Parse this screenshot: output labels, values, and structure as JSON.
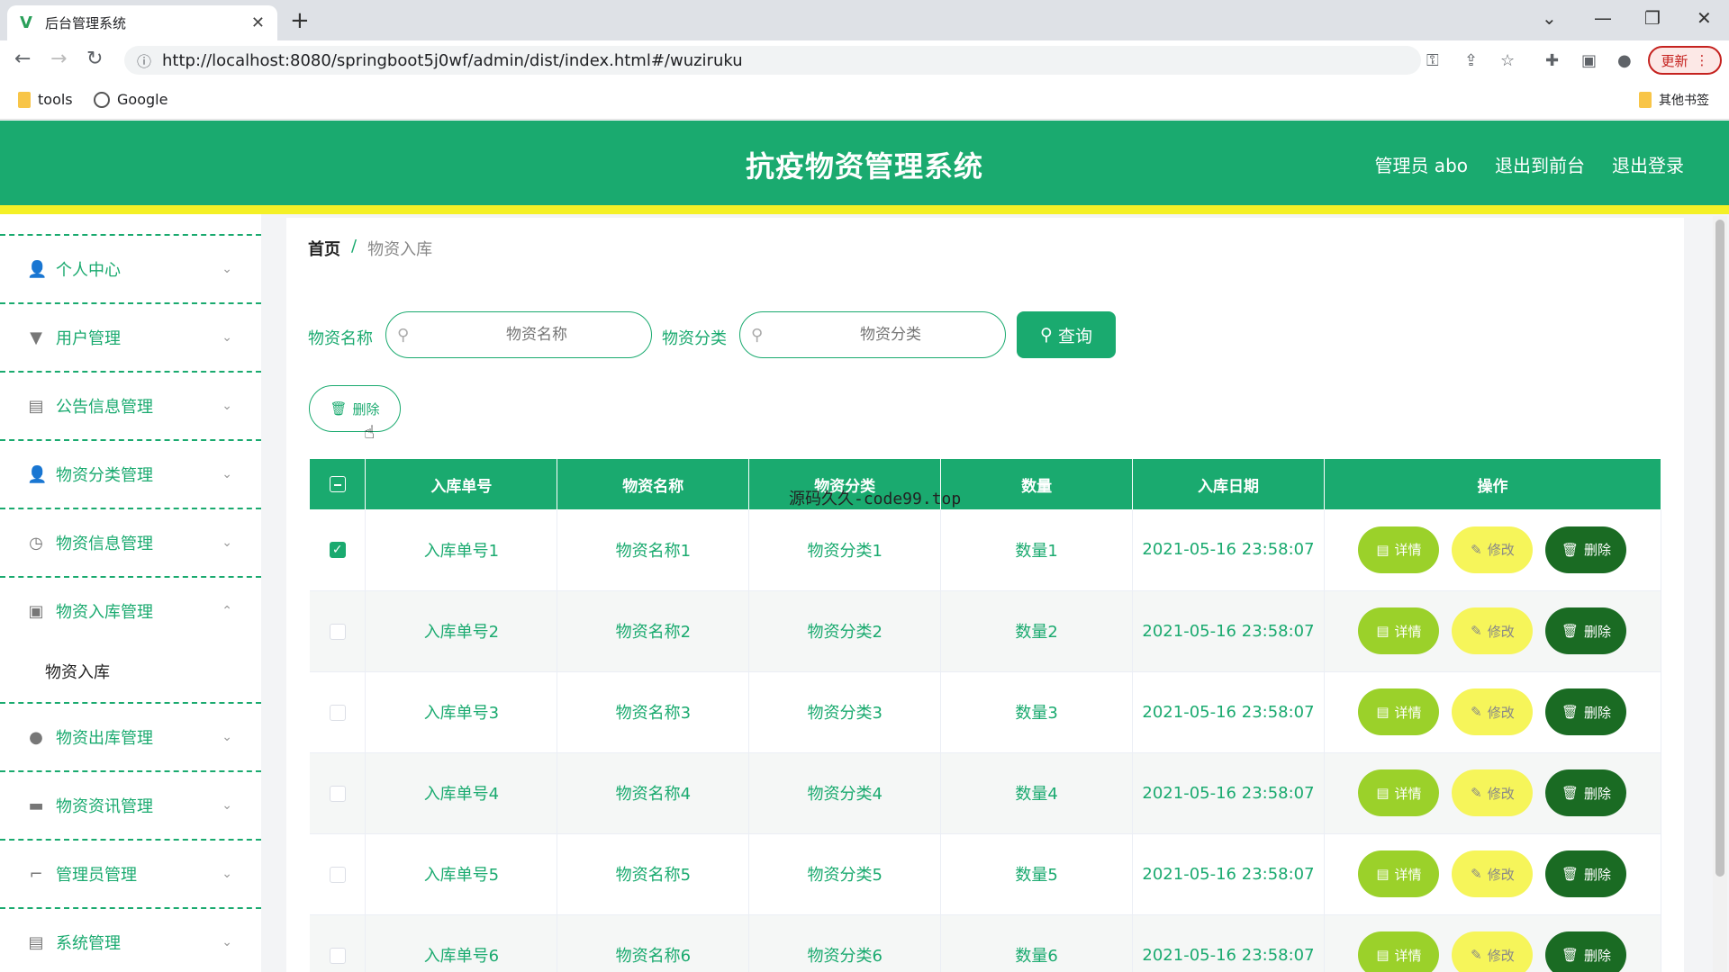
{
  "browser": {
    "tab_title": "后台管理系统",
    "url": "http://localhost:8080/springboot5j0wf/admin/dist/index.html#/wuziruku",
    "update_label": "更新",
    "bookmarks": [
      "tools",
      "Google"
    ],
    "other_bookmarks": "其他书签"
  },
  "header": {
    "title": "抗疫物资管理系统",
    "links": [
      "管理员 abo",
      "退出到前台",
      "退出登录"
    ]
  },
  "sidebar": {
    "items": [
      {
        "label": "个人中心",
        "icon": "user-icon",
        "expanded": false
      },
      {
        "label": "用户管理",
        "icon": "user-manage-icon",
        "expanded": false
      },
      {
        "label": "公告信息管理",
        "icon": "chart-icon",
        "expanded": false
      },
      {
        "label": "物资分类管理",
        "icon": "user-icon",
        "expanded": false
      },
      {
        "label": "物资信息管理",
        "icon": "clock-icon",
        "expanded": false
      },
      {
        "label": "物资入库管理",
        "icon": "clipboard-icon",
        "expanded": true
      },
      {
        "label": "物资出库管理",
        "icon": "bulb-icon",
        "expanded": false
      },
      {
        "label": "物资资讯管理",
        "icon": "briefcase-icon",
        "expanded": false
      },
      {
        "label": "管理员管理",
        "icon": "crop-icon",
        "expanded": false
      },
      {
        "label": "系统管理",
        "icon": "clipboard-icon",
        "expanded": false
      }
    ],
    "submenu_item": "物资入库"
  },
  "breadcrumb": {
    "home": "首页",
    "separator": "/",
    "current": "物资入库"
  },
  "search": {
    "name_label": "物资名称",
    "name_placeholder": "物资名称",
    "category_label": "物资分类",
    "category_placeholder": "物资分类",
    "button": "查询"
  },
  "batch_delete_label": "删除",
  "table": {
    "headers": [
      "入库单号",
      "物资名称",
      "物资分类",
      "数量",
      "入库日期",
      "操作"
    ],
    "rows": [
      {
        "no": "入库单号1",
        "name": "物资名称1",
        "category": "物资分类1",
        "qty": "数量1",
        "date": "2021-05-16 23:58:07",
        "checked": true
      },
      {
        "no": "入库单号2",
        "name": "物资名称2",
        "category": "物资分类2",
        "qty": "数量2",
        "date": "2021-05-16 23:58:07",
        "checked": false
      },
      {
        "no": "入库单号3",
        "name": "物资名称3",
        "category": "物资分类3",
        "qty": "数量3",
        "date": "2021-05-16 23:58:07",
        "checked": false
      },
      {
        "no": "入库单号4",
        "name": "物资名称4",
        "category": "物资分类4",
        "qty": "数量4",
        "date": "2021-05-16 23:58:07",
        "checked": false
      },
      {
        "no": "入库单号5",
        "name": "物资名称5",
        "category": "物资分类5",
        "qty": "数量5",
        "date": "2021-05-16 23:58:07",
        "checked": false
      },
      {
        "no": "入库单号6",
        "name": "物资名称6",
        "category": "物资分类6",
        "qty": "数量6",
        "date": "2021-05-16 23:58:07",
        "checked": false
      }
    ],
    "actions": {
      "detail": "详情",
      "edit": "修改",
      "delete": "删除"
    }
  },
  "overlay_text": "源码久久-code99.top",
  "colors": {
    "primary": "#1aaa6f",
    "stripe": "#f4f026",
    "detail": "#9bd12a",
    "edit": "#f6f55a",
    "delete": "#1a6b23"
  }
}
